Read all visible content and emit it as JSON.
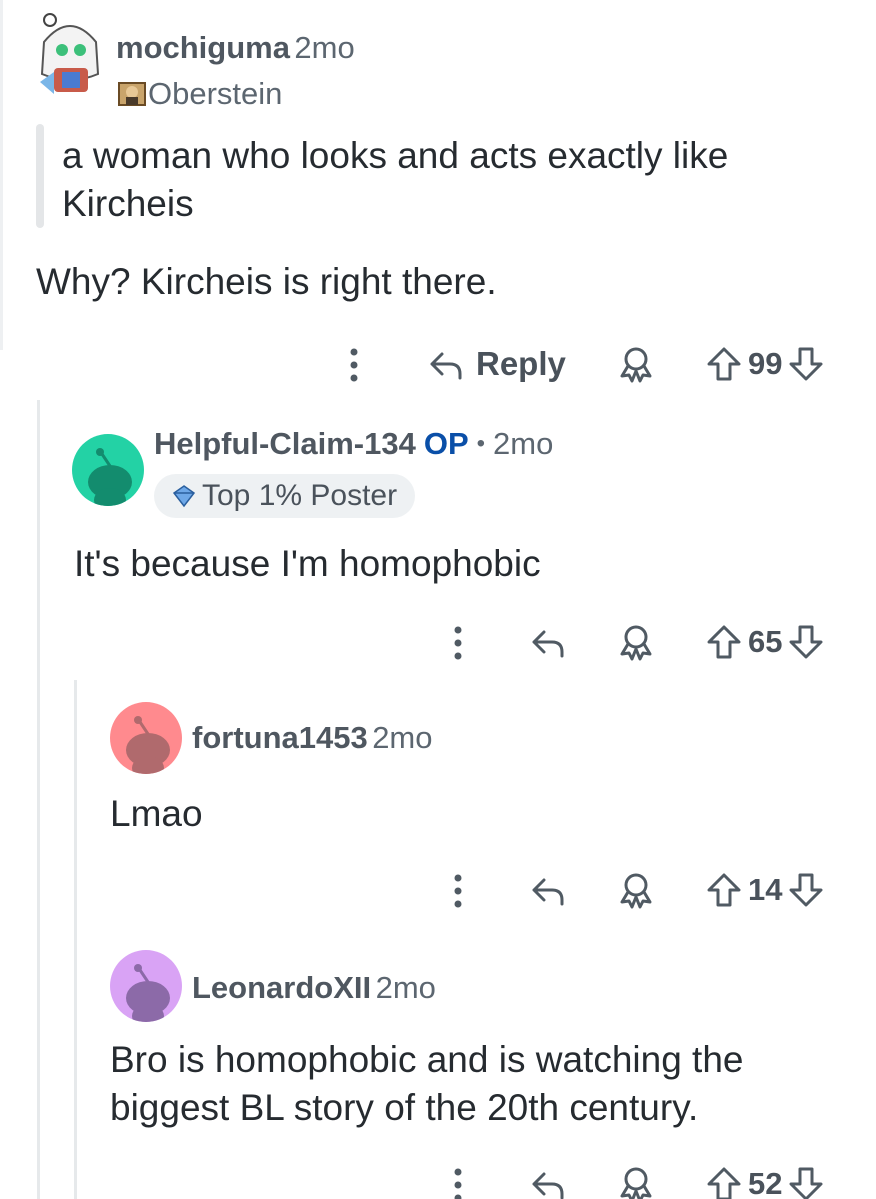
{
  "comments": [
    {
      "username": "mochiguma",
      "time": "2mo",
      "flair": "Oberstein",
      "quote": "a woman who looks and acts exactly like Kircheis",
      "text": "Why? Kircheis is right there.",
      "reply_label": "Reply",
      "votes": "99",
      "avatar_color": "#f4f4f0"
    },
    {
      "username": "Helpful-Claim-134",
      "op_label": "OP",
      "separator": "•",
      "time": "2mo",
      "badge": "Top 1% Poster",
      "text": "It's because I'm homophobic",
      "votes": "65",
      "avatar_color": "#23d2a5"
    },
    {
      "username": "fortuna1453",
      "time": "2mo",
      "text": "Lmao",
      "votes": "14",
      "avatar_color": "#ff8a8e"
    },
    {
      "username": "LeonardoXII",
      "time": "2mo",
      "text": "Bro is homophobic and is watching the biggest BL story of the 20th century.",
      "votes": "52",
      "avatar_color": "#d9a3f5"
    }
  ],
  "colors": {
    "op_blue": "#0a4fa8",
    "icon_gray": "#505a63",
    "thread_line": "#e6e9eb",
    "badge_bg": "#eef1f3"
  },
  "icons": [
    "more-vertical-icon",
    "reply-arrow-icon",
    "award-icon",
    "upvote-arrow-icon",
    "downvote-arrow-icon",
    "snoo-avatar-icon",
    "flair-portrait-icon",
    "top-poster-badge-icon"
  ]
}
